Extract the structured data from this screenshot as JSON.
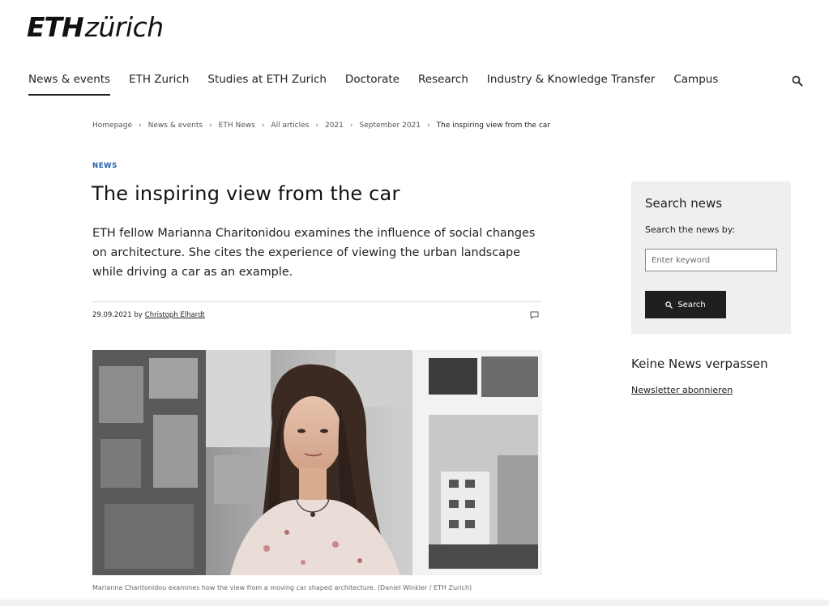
{
  "logo": {
    "eth": "ETH",
    "zurich": "zürich"
  },
  "nav": {
    "items": [
      {
        "label": "News & events",
        "active": true
      },
      {
        "label": "ETH Zurich"
      },
      {
        "label": "Studies at ETH Zurich"
      },
      {
        "label": "Doctorate"
      },
      {
        "label": "Research"
      },
      {
        "label": "Industry & Knowledge Transfer"
      },
      {
        "label": "Campus"
      }
    ],
    "search_icon": "search-icon"
  },
  "breadcrumb": [
    "Homepage",
    "News & events",
    "ETH News",
    "All articles",
    "2021",
    "September 2021",
    "The inspiring view from the car"
  ],
  "article": {
    "kicker": "NEWS",
    "title": "The inspiring view from the car",
    "lead": "ETH fellow Marianna Charitonidou examines the influence of social changes on architecture. She cites the experience of viewing the urban landscape while driving a car as an example.",
    "date_by": "29.09.2021 by",
    "author": "Christoph Elhardt",
    "comment_icon": "comment-icon",
    "caption": "Marianna Charitonidou examines how the view from a moving car shaped architecture. (Daniel Winkler / ETH Zurich)"
  },
  "sidebar": {
    "title": "Search news",
    "subtitle": "Search the news by:",
    "input_placeholder": "Enter keyword",
    "button_label": "Search"
  },
  "newsletter": {
    "title": "Keine News verpassen",
    "link": "Newsletter abonnieren"
  },
  "colors": {
    "accent": "#215caf",
    "dark": "#1f1f1f",
    "panel": "#efefef"
  }
}
